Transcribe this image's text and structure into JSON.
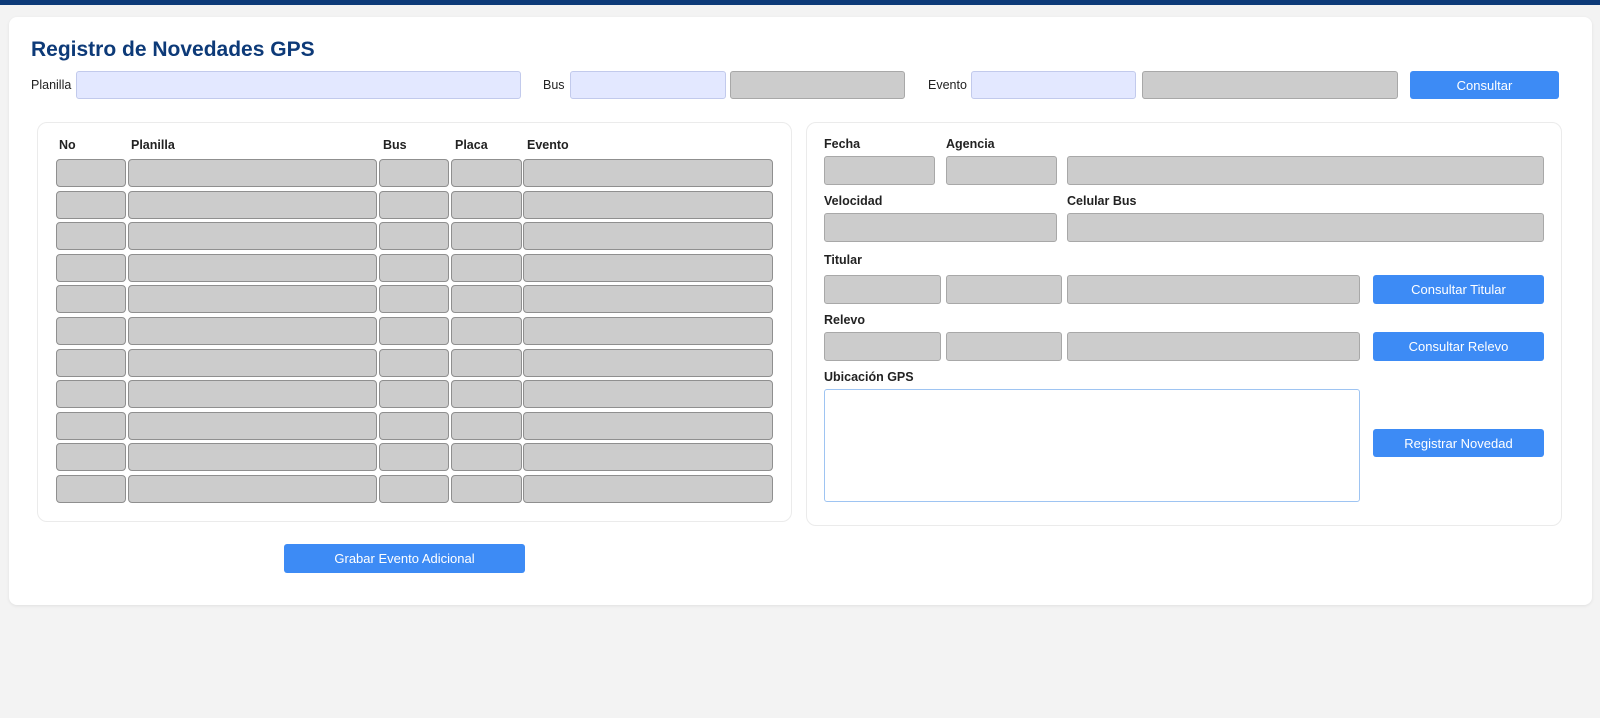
{
  "page": {
    "title": "Registro de Novedades GPS"
  },
  "filters": {
    "planilla_label": "Planilla",
    "planilla_value": "",
    "bus_label": "Bus",
    "bus_value": "",
    "bus_desc_value": "",
    "evento_label": "Evento",
    "evento_value": "",
    "evento_desc_value": "",
    "consultar_label": "Consultar"
  },
  "grid": {
    "headers": [
      "No",
      "Planilla",
      "Bus",
      "Placa",
      "Evento"
    ],
    "row_count": 11
  },
  "details": {
    "fecha_label": "Fecha",
    "agencia_label": "Agencia",
    "velocidad_label": "Velocidad",
    "celular_label": "Celular Bus",
    "titular_label": "Titular",
    "relevo_label": "Relevo",
    "ubicacion_label": "Ubicación GPS",
    "ubicacion_value": "",
    "consultar_titular_label": "Consultar Titular",
    "consultar_relevo_label": "Consultar Relevo",
    "registrar_label": "Registrar Novedad"
  },
  "footer": {
    "grabar_label": "Grabar Evento Adicional"
  },
  "colors": {
    "header_bar": "#0d3a78",
    "accent_button": "#3d8bf5",
    "editable_input": "#e3e8ff",
    "readonly_input": "#cccccc"
  }
}
